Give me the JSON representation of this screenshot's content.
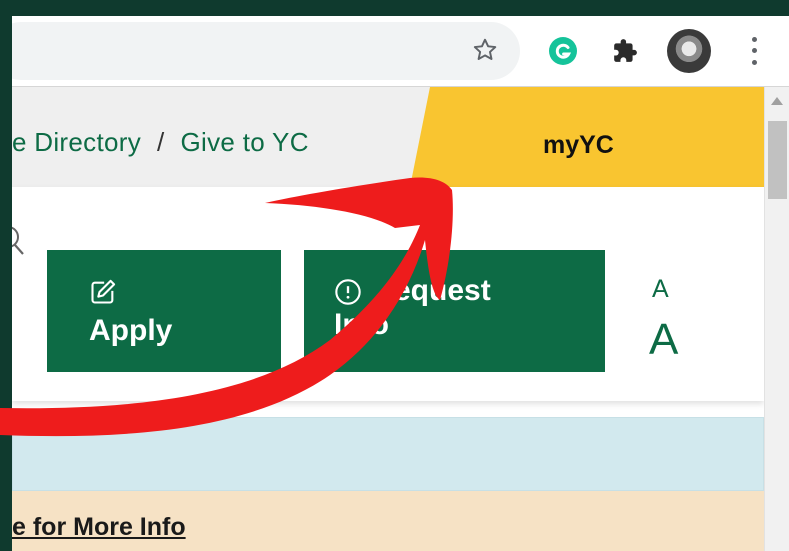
{
  "breadcrumb": {
    "directory_label": "e Directory",
    "separator": "/",
    "give_label": "Give to YC"
  },
  "myyc_label": "myYC",
  "buttons": {
    "apply_label": "Apply",
    "request_label_line1": "equest",
    "request_label_line2": "Info"
  },
  "font_size": {
    "small": "A",
    "large": "A"
  },
  "notice": {
    "more_info_label": "e for More Info"
  },
  "colors": {
    "brand_green": "#0d6b45",
    "myyc_yellow": "#f9c530",
    "arrow_red": "#ee1c1c",
    "frame": "#0f3a2e"
  },
  "icons": {
    "star": "star-icon",
    "grammarly": "grammarly-icon",
    "extensions": "puzzle-icon",
    "menu": "kebab-menu-icon",
    "apply": "edit-icon",
    "request": "info-circle-icon",
    "search": "search-icon"
  }
}
